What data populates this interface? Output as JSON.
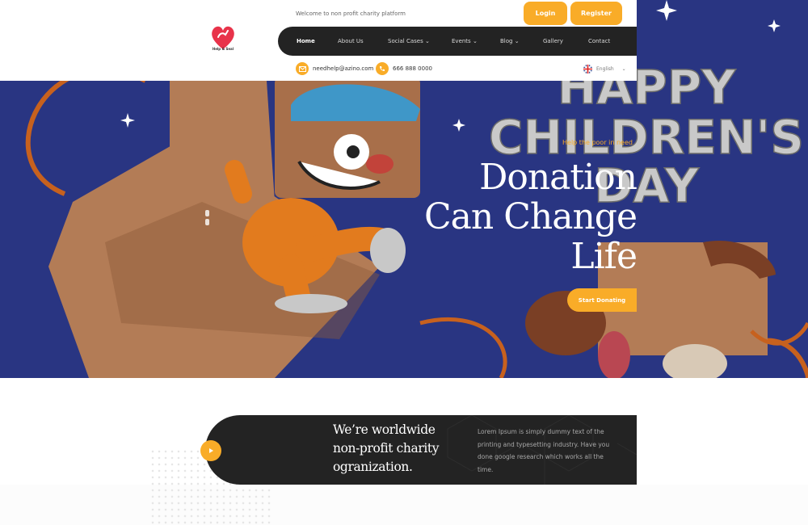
{
  "header": {
    "welcome": "Welcome to non profit charity platform",
    "logo_text": "Help & Seal",
    "login_label": "Login",
    "register_label": "Register",
    "email": "needhelp@azino.com",
    "phone": "666 888 0000",
    "language": "English"
  },
  "nav": {
    "items": [
      {
        "label": "Home",
        "active": true
      },
      {
        "label": "About Us"
      },
      {
        "label": "Social Cases",
        "dropdown": true
      },
      {
        "label": "Events",
        "dropdown": true
      },
      {
        "label": "Blog",
        "dropdown": true
      },
      {
        "label": "Gallery"
      },
      {
        "label": "Contact"
      }
    ]
  },
  "hero": {
    "tagline": "Help the poor in need",
    "title_lines": [
      "Donation",
      "Can Change",
      "Life"
    ],
    "cta_label": "Start Donating",
    "banner_lines": [
      "HAPPY",
      "CHILDREN'S",
      "DAY"
    ]
  },
  "about": {
    "title_lines": [
      "We’re worldwide",
      "non-profit charity",
      "ogranization."
    ],
    "text": "Lorem Ipsum is simply dummy text of the printing and typesetting industry. Have you done google research which works all the time."
  },
  "colors": {
    "accent": "#f9ac28",
    "dark": "#232323",
    "hero_bg": "#2c3a8a"
  }
}
